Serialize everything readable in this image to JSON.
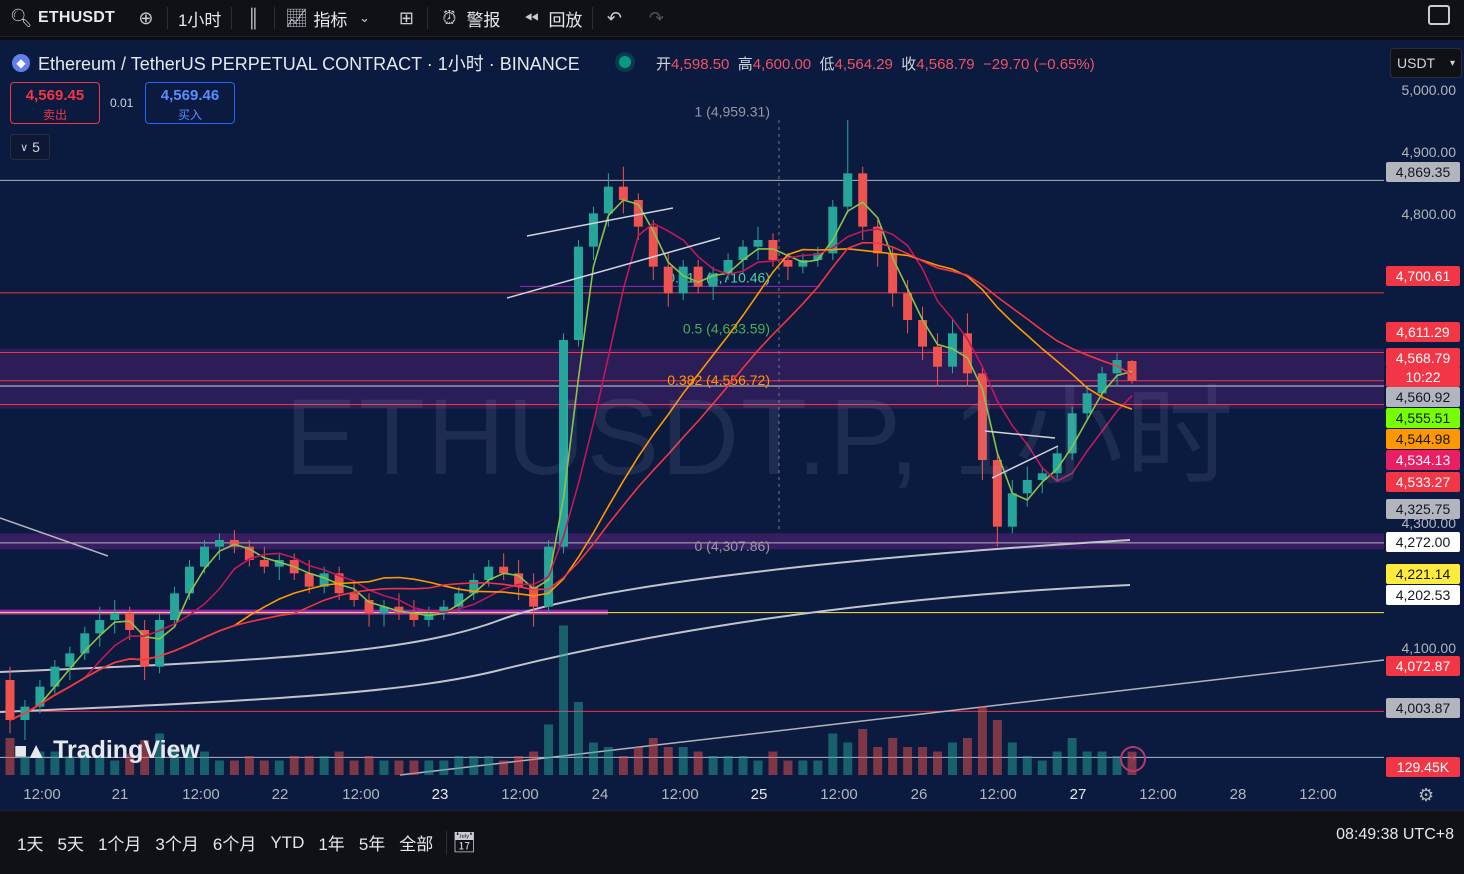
{
  "toolbar": {
    "symbol": "ETHUSDT",
    "interval": "1小时",
    "indicators_label": "指标",
    "alert_label": "警报",
    "replay_label": "回放"
  },
  "legend": {
    "title": "Ethereum / TetherUS PERPETUAL CONTRACT · 1小时 · BINANCE",
    "open_label": "开",
    "open": "4,598.50",
    "high_label": "高",
    "high": "4,600.00",
    "low_label": "低",
    "low": "4,564.29",
    "close_label": "收",
    "close": "4,568.79",
    "change": "−29.70 (−0.65%)"
  },
  "trade": {
    "sell_price": "4,569.45",
    "sell_label": "卖出",
    "spread": "0.01",
    "buy_price": "4,569.46",
    "buy_label": "买入"
  },
  "collapse_count": "5",
  "currency": "USDT",
  "watermark": "ETHUSDT.P, 1小时",
  "fib": {
    "top": "1 (4,959.31)",
    "f618": "0.618 (4,710.46)",
    "f50": "0.5 (4,633.59)",
    "f382": "0.382 (4,556.72)",
    "bottom": "0 (4,307.86)"
  },
  "price_axis": {
    "ticks": [
      "5,000.00",
      "4,900.00",
      "4,800.00",
      "4,300.00",
      "4,100.00"
    ],
    "tags": [
      {
        "label": "4,869.35",
        "bg": "#b2b5be",
        "fg": "#131722"
      },
      {
        "label": "4,700.61",
        "bg": "#f23645",
        "fg": "#ffffff"
      },
      {
        "label": "4,611.29",
        "bg": "#f23645",
        "fg": "#ffffff"
      },
      {
        "label": "4,568.79",
        "bg": "#f23645",
        "fg": "#ffffff"
      },
      {
        "label": "10:22",
        "bg": "#f23645",
        "fg": "#ffffff"
      },
      {
        "label": "4,560.92",
        "bg": "#b2b5be",
        "fg": "#131722"
      },
      {
        "label": "4,555.51",
        "bg": "#76ff03",
        "fg": "#131722"
      },
      {
        "label": "4,544.98",
        "bg": "#ff9800",
        "fg": "#131722"
      },
      {
        "label": "4,534.13",
        "bg": "#e91e63",
        "fg": "#ffffff"
      },
      {
        "label": "4,533.27",
        "bg": "#f23645",
        "fg": "#ffffff"
      },
      {
        "label": "4,325.75",
        "bg": "#b2b5be",
        "fg": "#131722"
      },
      {
        "label": "4,272.00",
        "bg": "#ffffff",
        "fg": "#131722"
      },
      {
        "label": "4,221.14",
        "bg": "#ffeb3b",
        "fg": "#131722"
      },
      {
        "label": "4,202.53",
        "bg": "#ffffff",
        "fg": "#131722"
      },
      {
        "label": "4,072.87",
        "bg": "#f23645",
        "fg": "#ffffff"
      },
      {
        "label": "4,003.87",
        "bg": "#b2b5be",
        "fg": "#131722"
      },
      {
        "label": "129.45K",
        "bg": "#f23645",
        "fg": "#ffffff"
      }
    ]
  },
  "time_axis": [
    "12:00",
    "21",
    "12:00",
    "22",
    "12:00",
    "23",
    "12:00",
    "24",
    "12:00",
    "25",
    "12:00",
    "26",
    "12:00",
    "27",
    "12:00",
    "28",
    "12:00"
  ],
  "branding": "TradingView",
  "ranges": [
    "1天",
    "5天",
    "1个月",
    "3个月",
    "6个月",
    "YTD",
    "1年",
    "5年",
    "全部"
  ],
  "clock": "08:49:38 UTC+8",
  "chart_data": {
    "type": "candlestick",
    "symbol": "ETHUSDT.P",
    "interval": "1h",
    "ylim": [
      4000,
      5020
    ],
    "candles": [
      [
        4120,
        4140,
        4040,
        4060
      ],
      [
        4060,
        4090,
        4030,
        4080
      ],
      [
        4080,
        4120,
        4070,
        4110
      ],
      [
        4110,
        4150,
        4100,
        4140
      ],
      [
        4140,
        4170,
        4120,
        4160
      ],
      [
        4160,
        4200,
        4150,
        4190
      ],
      [
        4190,
        4230,
        4170,
        4210
      ],
      [
        4210,
        4240,
        4190,
        4220
      ],
      [
        4220,
        4230,
        4180,
        4195
      ],
      [
        4195,
        4210,
        4120,
        4140
      ],
      [
        4140,
        4220,
        4130,
        4210
      ],
      [
        4210,
        4260,
        4200,
        4250
      ],
      [
        4250,
        4300,
        4240,
        4290
      ],
      [
        4290,
        4330,
        4280,
        4320
      ],
      [
        4320,
        4340,
        4300,
        4330
      ],
      [
        4330,
        4345,
        4310,
        4320
      ],
      [
        4320,
        4330,
        4290,
        4300
      ],
      [
        4300,
        4320,
        4280,
        4290
      ],
      [
        4290,
        4310,
        4270,
        4300
      ],
      [
        4300,
        4310,
        4270,
        4280
      ],
      [
        4280,
        4300,
        4250,
        4260
      ],
      [
        4260,
        4290,
        4250,
        4280
      ],
      [
        4280,
        4290,
        4240,
        4250
      ],
      [
        4250,
        4270,
        4230,
        4240
      ],
      [
        4240,
        4250,
        4200,
        4220
      ],
      [
        4220,
        4240,
        4200,
        4230
      ],
      [
        4230,
        4250,
        4210,
        4220
      ],
      [
        4220,
        4240,
        4200,
        4210
      ],
      [
        4210,
        4230,
        4200,
        4220
      ],
      [
        4220,
        4240,
        4210,
        4230
      ],
      [
        4230,
        4260,
        4220,
        4250
      ],
      [
        4250,
        4280,
        4240,
        4270
      ],
      [
        4270,
        4300,
        4260,
        4290
      ],
      [
        4290,
        4310,
        4270,
        4280
      ],
      [
        4280,
        4300,
        4240,
        4260
      ],
      [
        4260,
        4280,
        4200,
        4230
      ],
      [
        4230,
        4330,
        4220,
        4320
      ],
      [
        4320,
        4640,
        4310,
        4630
      ],
      [
        4630,
        4780,
        4620,
        4770
      ],
      [
        4770,
        4830,
        4750,
        4820
      ],
      [
        4820,
        4880,
        4800,
        4860
      ],
      [
        4860,
        4890,
        4820,
        4840
      ],
      [
        4840,
        4850,
        4780,
        4800
      ],
      [
        4800,
        4810,
        4720,
        4740
      ],
      [
        4740,
        4760,
        4680,
        4700
      ],
      [
        4700,
        4750,
        4690,
        4740
      ],
      [
        4740,
        4750,
        4700,
        4710
      ],
      [
        4710,
        4740,
        4690,
        4730
      ],
      [
        4730,
        4760,
        4720,
        4750
      ],
      [
        4750,
        4780,
        4730,
        4770
      ],
      [
        4770,
        4800,
        4750,
        4780
      ],
      [
        4780,
        4790,
        4740,
        4750
      ],
      [
        4750,
        4760,
        4720,
        4740
      ],
      [
        4740,
        4760,
        4730,
        4750
      ],
      [
        4750,
        4770,
        4740,
        4760
      ],
      [
        4760,
        4840,
        4750,
        4830
      ],
      [
        4830,
        4960,
        4820,
        4880
      ],
      [
        4880,
        4890,
        4780,
        4800
      ],
      [
        4800,
        4810,
        4740,
        4760
      ],
      [
        4760,
        4770,
        4680,
        4700
      ],
      [
        4700,
        4720,
        4640,
        4660
      ],
      [
        4660,
        4680,
        4600,
        4620
      ],
      [
        4620,
        4640,
        4560,
        4590
      ],
      [
        4590,
        4660,
        4580,
        4640
      ],
      [
        4640,
        4670,
        4560,
        4580
      ],
      [
        4580,
        4590,
        4420,
        4450
      ],
      [
        4450,
        4460,
        4320,
        4350
      ],
      [
        4350,
        4420,
        4340,
        4400
      ],
      [
        4400,
        4440,
        4380,
        4420
      ],
      [
        4420,
        4440,
        4400,
        4430
      ],
      [
        4430,
        4470,
        4420,
        4460
      ],
      [
        4460,
        4530,
        4450,
        4520
      ],
      [
        4520,
        4560,
        4510,
        4550
      ],
      [
        4550,
        4590,
        4540,
        4580
      ],
      [
        4580,
        4610,
        4560,
        4600
      ],
      [
        4598.5,
        4600,
        4564.29,
        4568.79
      ]
    ],
    "horizontal_levels": [
      4869.35,
      4700.61,
      4611.29,
      4568.79,
      4560.92,
      4533.27,
      4325.75,
      4221.14,
      4072.87,
      4003.87
    ],
    "moving_averages": [
      {
        "value": 4555.51,
        "color": "#76ff03"
      },
      {
        "value": 4544.98,
        "color": "#ff9800"
      },
      {
        "value": 4534.13,
        "color": "#e91e63"
      },
      {
        "value": 4272.0,
        "color": "#ffffff"
      },
      {
        "value": 4202.53,
        "color": "#ffffff"
      }
    ],
    "fibonacci": [
      {
        "ratio": 1,
        "price": 4959.31
      },
      {
        "ratio": 0.618,
        "price": 4710.46
      },
      {
        "ratio": 0.5,
        "price": 4633.59
      },
      {
        "ratio": 0.382,
        "price": 4556.72
      },
      {
        "ratio": 0,
        "price": 4307.86
      }
    ],
    "volume_last": "129.45K"
  }
}
